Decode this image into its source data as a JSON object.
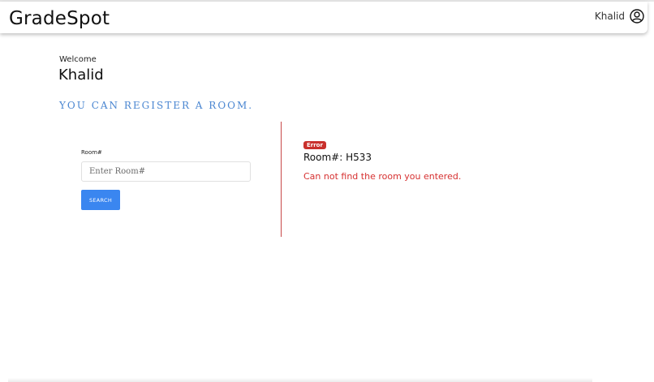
{
  "app": {
    "brand": "GradeSpot"
  },
  "header": {
    "user_name": "Khalid",
    "user_icon": "user-circle-icon"
  },
  "greeting": {
    "welcome": "Welcome",
    "name": "Khalid",
    "tagline": "YOU CAN REGISTER A ROOM."
  },
  "form": {
    "room_label": "Room#",
    "room_placeholder": "Enter Room#",
    "room_value": "",
    "search_label": "SEARCH"
  },
  "result": {
    "badge": "Error",
    "room_prefix": "Room#:",
    "room_number": "H533",
    "message": "Can not find the room you entered."
  },
  "colors": {
    "accent_blue": "#3a86f0",
    "tagline_blue": "#4a86d1",
    "error_red": "#d63030",
    "divider_red": "#c74848"
  }
}
